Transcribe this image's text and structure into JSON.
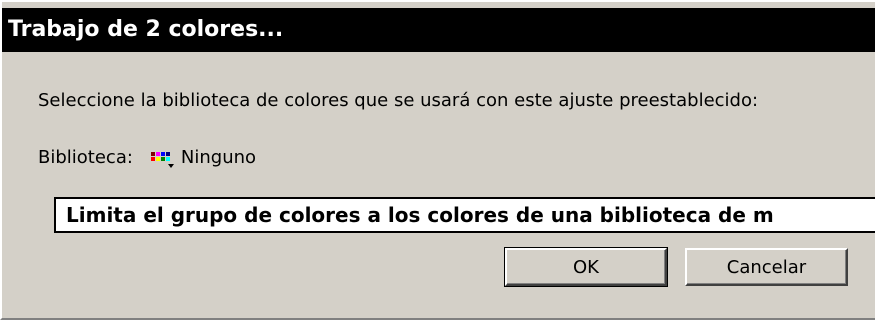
{
  "dialog": {
    "title": "Trabajo de 2 colores...",
    "prompt": "Seleccione la biblioteca de colores que se usará con este ajuste preestablecido:",
    "library_label": "Biblioteca:",
    "library_value": "Ninguno",
    "library_icon": "color-swatch-library-icon",
    "tooltip": "Limita el grupo de colores a los colores de una biblioteca de m",
    "ok_label": "OK",
    "cancel_label": "Cancelar"
  },
  "colors": {
    "face": "#d4d0c8",
    "titlebar": "#000000",
    "tooltip_bg": "#ffffff"
  }
}
